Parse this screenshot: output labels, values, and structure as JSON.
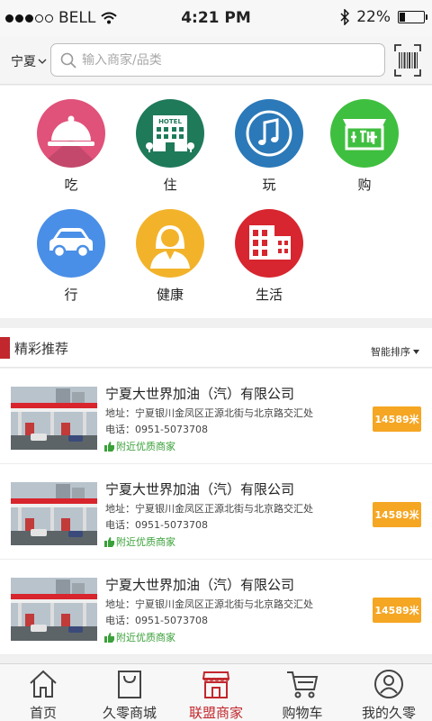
{
  "status_bar": {
    "carrier": "BELL",
    "time": "4:21 PM",
    "battery_percent_label": "22%",
    "battery_level": 0.22
  },
  "header": {
    "city": "宁夏",
    "search_placeholder": "输入商家/品类",
    "search_value": ""
  },
  "categories": [
    {
      "label": "吃",
      "icon": "service-bell-icon",
      "color": "#e0527a"
    },
    {
      "label": "住",
      "icon": "hotel-icon",
      "color": "#1f7a5a"
    },
    {
      "label": "玩",
      "icon": "music-note-icon",
      "color": "#2b79b8"
    },
    {
      "label": "购",
      "icon": "shop-icon",
      "color": "#3fbf3f"
    },
    {
      "label": "行",
      "icon": "car-icon",
      "color": "#4a8fe7"
    },
    {
      "label": "健康",
      "icon": "person-icon",
      "color": "#f2b32b"
    },
    {
      "label": "生活",
      "icon": "building-icon",
      "color": "#d7262f"
    }
  ],
  "hotel_sign_text": "HOTEL",
  "section": {
    "title": "精彩推荐",
    "sort_label": "智能排序"
  },
  "listings": [
    {
      "name": "宁夏大世界加油（汽）有限公司",
      "address": "地址：宁夏银川金凤区正源北街与北京路交汇处",
      "phone": "电话：0951-5073708",
      "tag": "附近优质商家",
      "distance": "14589米"
    },
    {
      "name": "宁夏大世界加油（汽）有限公司",
      "address": "地址：宁夏银川金凤区正源北街与北京路交汇处",
      "phone": "电话：0951-5073708",
      "tag": "附近优质商家",
      "distance": "14589米"
    },
    {
      "name": "宁夏大世界加油（汽）有限公司",
      "address": "地址：宁夏银川金凤区正源北街与北京路交汇处",
      "phone": "电话：0951-5073708",
      "tag": "附近优质商家",
      "distance": "14589米"
    }
  ],
  "tabs": [
    {
      "label": "首页",
      "icon": "home-icon",
      "active": false
    },
    {
      "label": "久零商城",
      "icon": "shopping-bag-icon",
      "active": false
    },
    {
      "label": "联盟商家",
      "icon": "storefront-icon",
      "active": true
    },
    {
      "label": "购物车",
      "icon": "cart-icon",
      "active": false
    },
    {
      "label": "我的久零",
      "icon": "user-icon",
      "active": false
    }
  ],
  "colors": {
    "accent": "#c1272d",
    "distance_badge": "#f5a623",
    "tag_green": "#3aa13a"
  }
}
